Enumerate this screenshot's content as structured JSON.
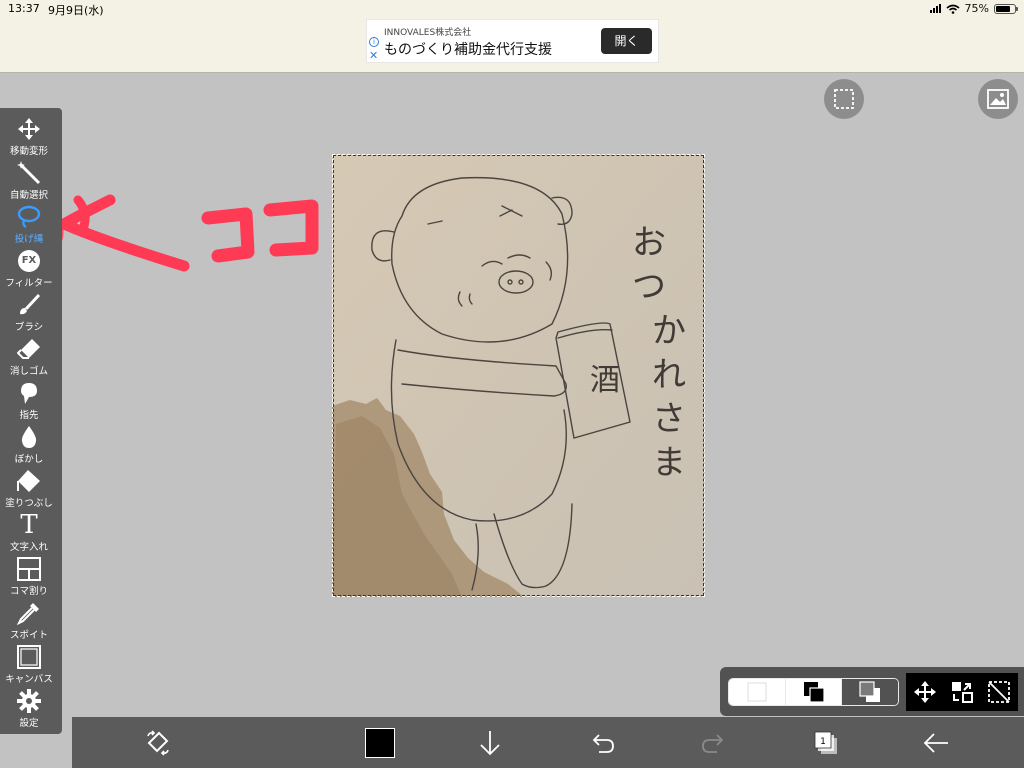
{
  "status_bar": {
    "time": "13:37",
    "date": "9月9日(水)",
    "battery_level": 0.75,
    "battery_text": "75%"
  },
  "ad": {
    "company": "INNOVALES株式会社",
    "headline": "ものづくり補助金代行支援",
    "open_button": "開く",
    "info_icon": "info-icon",
    "close_icon": "close-x-icon"
  },
  "tools": [
    {
      "label": "移動変形",
      "icon": "move-arrows-icon"
    },
    {
      "label": "自動選択",
      "icon": "magic-wand-icon"
    },
    {
      "label": "投げ縄",
      "icon": "lasso-icon",
      "active": true
    },
    {
      "label": "フィルター",
      "icon": "fx-icon",
      "glyph": "FX"
    },
    {
      "label": "ブラシ",
      "icon": "brush-icon"
    },
    {
      "label": "消しゴム",
      "icon": "eraser-icon"
    },
    {
      "label": "指先",
      "icon": "finger-smudge-icon"
    },
    {
      "label": "ぼかし",
      "icon": "blur-drop-icon"
    },
    {
      "label": "塗りつぶし",
      "icon": "bucket-fill-icon"
    },
    {
      "label": "文字入れ",
      "icon": "text-icon",
      "glyph": "T"
    },
    {
      "label": "コマ割り",
      "icon": "panel-divide-icon"
    },
    {
      "label": "スポイト",
      "icon": "eyedropper-icon"
    },
    {
      "label": "キャンバス",
      "icon": "canvas-icon"
    },
    {
      "label": "設定",
      "icon": "gear-icon"
    }
  ],
  "colors": {
    "accent": "#3a9cff",
    "annotation": "#ff3a55",
    "current_color": "#000000",
    "panel": "#5b5b5b"
  },
  "annotation": {
    "text": "コ コ",
    "note": "handwritten arrow pointing at lasso tool"
  },
  "drawing": {
    "vertical_text": [
      "お",
      "つ",
      "か",
      "れ",
      "さ",
      "ま"
    ],
    "can_label": "酒"
  },
  "layers": {
    "count": "1"
  },
  "bottom_icons": [
    "transform-icon",
    "color-swatch",
    "download-arrow-icon",
    "undo-icon",
    "redo-icon",
    "layers-icon",
    "back-arrow-icon"
  ]
}
